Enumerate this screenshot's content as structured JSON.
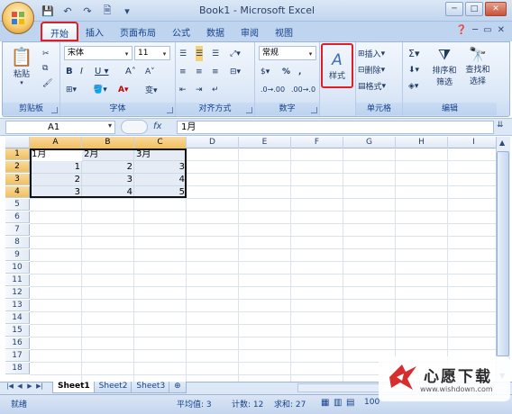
{
  "window": {
    "title": "Book1 - Microsoft Excel"
  },
  "tabs": [
    "开始",
    "插入",
    "页面布局",
    "公式",
    "数据",
    "审阅",
    "视图"
  ],
  "ribbon": {
    "clipboard": {
      "label": "剪贴板",
      "paste": "粘贴"
    },
    "font": {
      "label": "字体",
      "name": "宋体",
      "size": "11"
    },
    "alignment": {
      "label": "对齐方式"
    },
    "number": {
      "label": "数字",
      "format": "常规"
    },
    "styles": {
      "label": "样式"
    },
    "cells": {
      "label": "单元格",
      "insert": "插入",
      "delete": "删除",
      "format": "格式"
    },
    "editing": {
      "label": "编辑",
      "sort": "排序和",
      "filter": "筛选",
      "find": "查找和",
      "select": "选择"
    }
  },
  "formula_bar": {
    "name_box": "A1",
    "fx": "fx",
    "content": "1月"
  },
  "columns": [
    "A",
    "B",
    "C",
    "D",
    "E",
    "F",
    "G",
    "H",
    "I"
  ],
  "rows": [
    "1",
    "2",
    "3",
    "4",
    "5",
    "6",
    "7",
    "8",
    "9",
    "10",
    "11",
    "12",
    "13",
    "14",
    "15",
    "16",
    "17",
    "18"
  ],
  "cells": [
    [
      "1月",
      "2月",
      "3月"
    ],
    [
      "1",
      "2",
      "3"
    ],
    [
      "2",
      "3",
      "4"
    ],
    [
      "3",
      "4",
      "5"
    ]
  ],
  "sheets": [
    "Sheet1",
    "Sheet2",
    "Sheet3"
  ],
  "status": {
    "ready": "就绪",
    "average": "平均值: 3",
    "count": "计数: 12",
    "sum": "求和: 27",
    "zoom": "100"
  },
  "watermark": {
    "main": "心愿下载",
    "url": "www.wishdown.com"
  },
  "colors": {
    "highlight": "#e21d24",
    "selection": "#f1c05c",
    "ribbon": "#dce8f7"
  }
}
